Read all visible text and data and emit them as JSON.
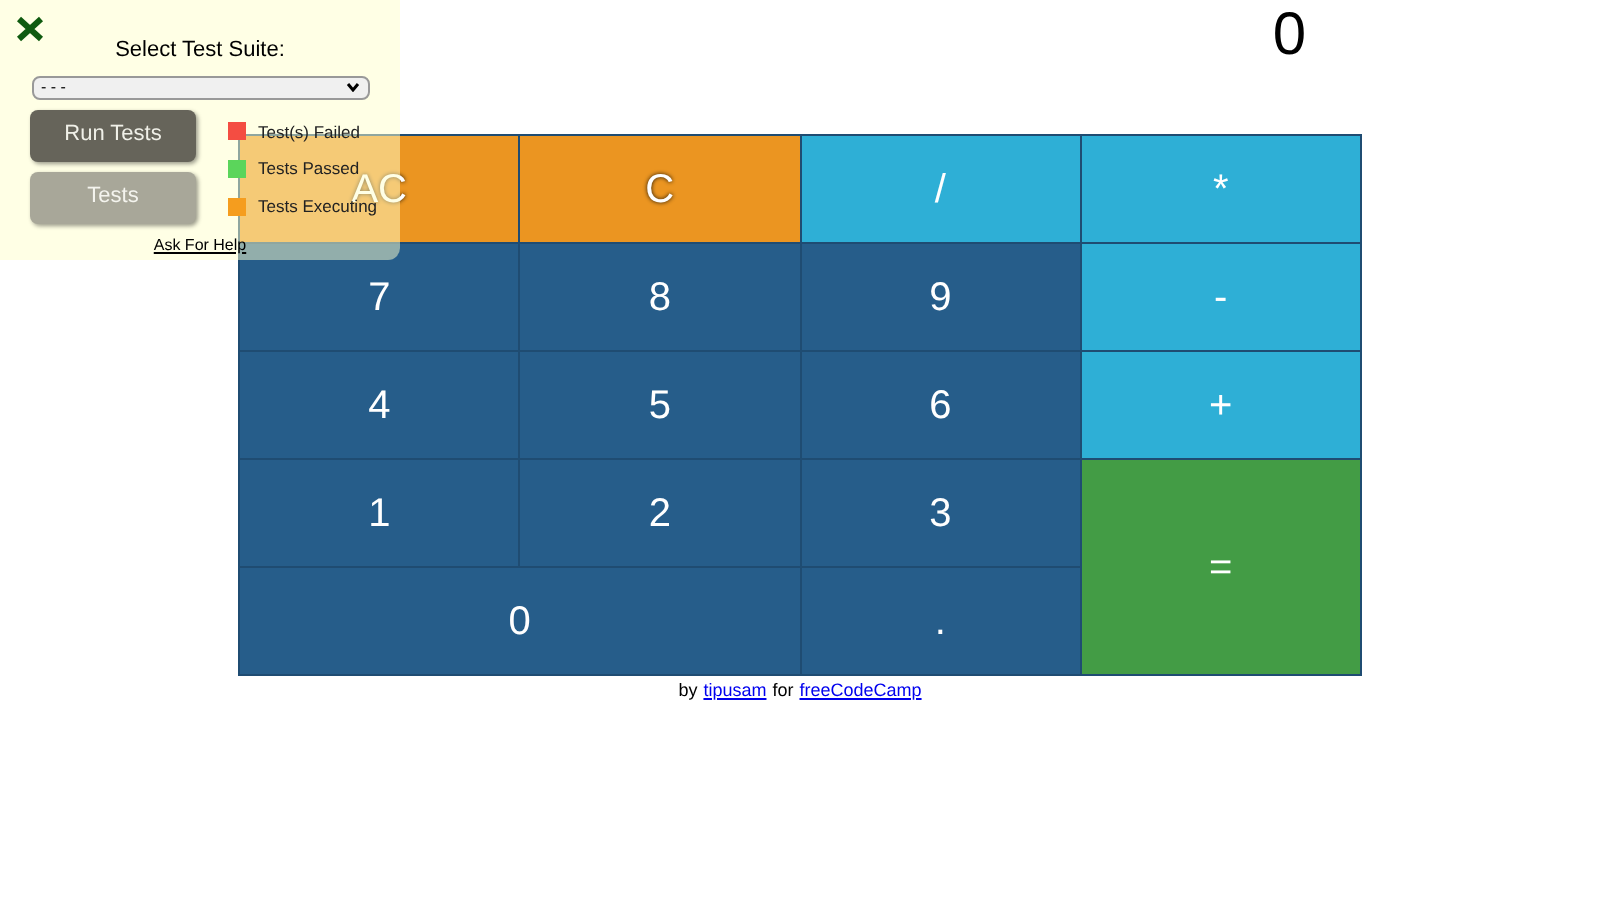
{
  "display": "0",
  "keys": [
    {
      "label": "AC",
      "kind": "clear"
    },
    {
      "label": "C",
      "kind": "clear"
    },
    {
      "label": "/",
      "kind": "operator"
    },
    {
      "label": "*",
      "kind": "operator"
    },
    {
      "label": "7",
      "kind": "digit"
    },
    {
      "label": "8",
      "kind": "digit"
    },
    {
      "label": "9",
      "kind": "digit"
    },
    {
      "label": "-",
      "kind": "operator"
    },
    {
      "label": "4",
      "kind": "digit"
    },
    {
      "label": "5",
      "kind": "digit"
    },
    {
      "label": "6",
      "kind": "digit"
    },
    {
      "label": "+",
      "kind": "operator"
    },
    {
      "label": "1",
      "kind": "digit"
    },
    {
      "label": "2",
      "kind": "digit"
    },
    {
      "label": "3",
      "kind": "digit"
    },
    {
      "label": "=",
      "kind": "equals",
      "tall": true
    },
    {
      "label": "0",
      "kind": "digit",
      "wide": true
    },
    {
      "label": ".",
      "kind": "digit"
    }
  ],
  "footer": {
    "prefix": "by",
    "author": "tipusam",
    "middle": "for",
    "site": "freeCodeCamp"
  },
  "test_panel": {
    "title": "Select Test Suite:",
    "suite_select": "- - -",
    "buttons": [
      {
        "label": "Run Tests",
        "kind": "primary"
      },
      {
        "label": "Tests",
        "kind": "secondary"
      }
    ],
    "legend": [
      {
        "label": "Test(s) Failed",
        "color": "#f44d42"
      },
      {
        "label": "Tests Passed",
        "color": "#5bd55b"
      },
      {
        "label": "Tests Executing",
        "color": "#f59d1e"
      }
    ],
    "help_link": "Ask For Help"
  }
}
